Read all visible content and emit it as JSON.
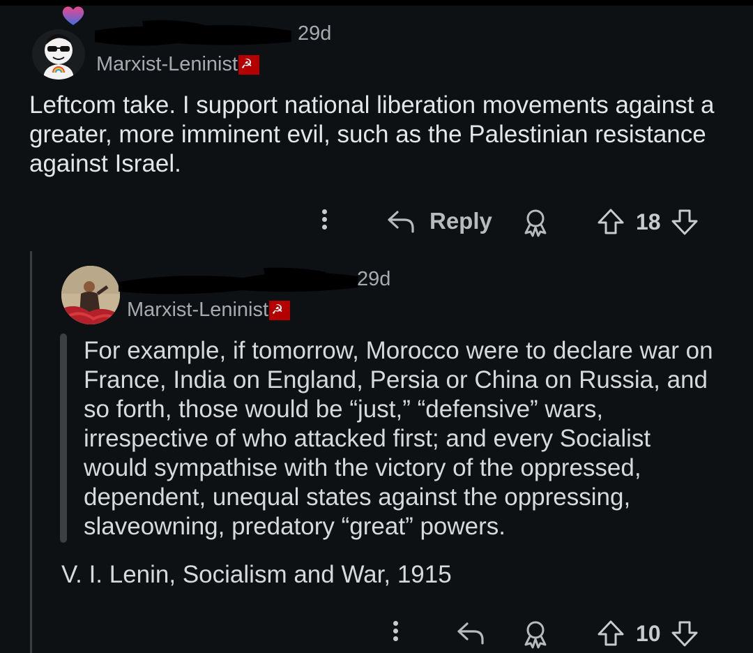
{
  "comments": [
    {
      "time": "29d",
      "flair": "Marxist-Leninist",
      "flair_badge": "☭",
      "body": "Leftcom take. I support national liberation movements against a greater, more imminent evil, such as the Palestinian resistance against Israel.",
      "actions": {
        "reply": "Reply",
        "score": "18"
      }
    },
    {
      "time": "29d",
      "flair": "Marxist-Leninist",
      "flair_badge": "☭",
      "quote": "For example, if tomorrow, Morocco were to declare war on France, India on England, Persia or China on Russia, and so forth, those would be “just,” “defensive” wars, irrespective of who attacked first; and every Socialist would sympathise with the victory of the oppressed, dependent, unequal states against the oppressing, slaveowning, predatory “great” powers.",
      "citation": "V. I. Lenin, Socialism and War, 1915",
      "actions": {
        "score": "10"
      }
    }
  ],
  "icons": {
    "more": "more-vertical-icon",
    "reply": "reply-arrow-icon",
    "award": "award-icon",
    "upvote": "upvote-icon",
    "downvote": "downvote-icon"
  }
}
